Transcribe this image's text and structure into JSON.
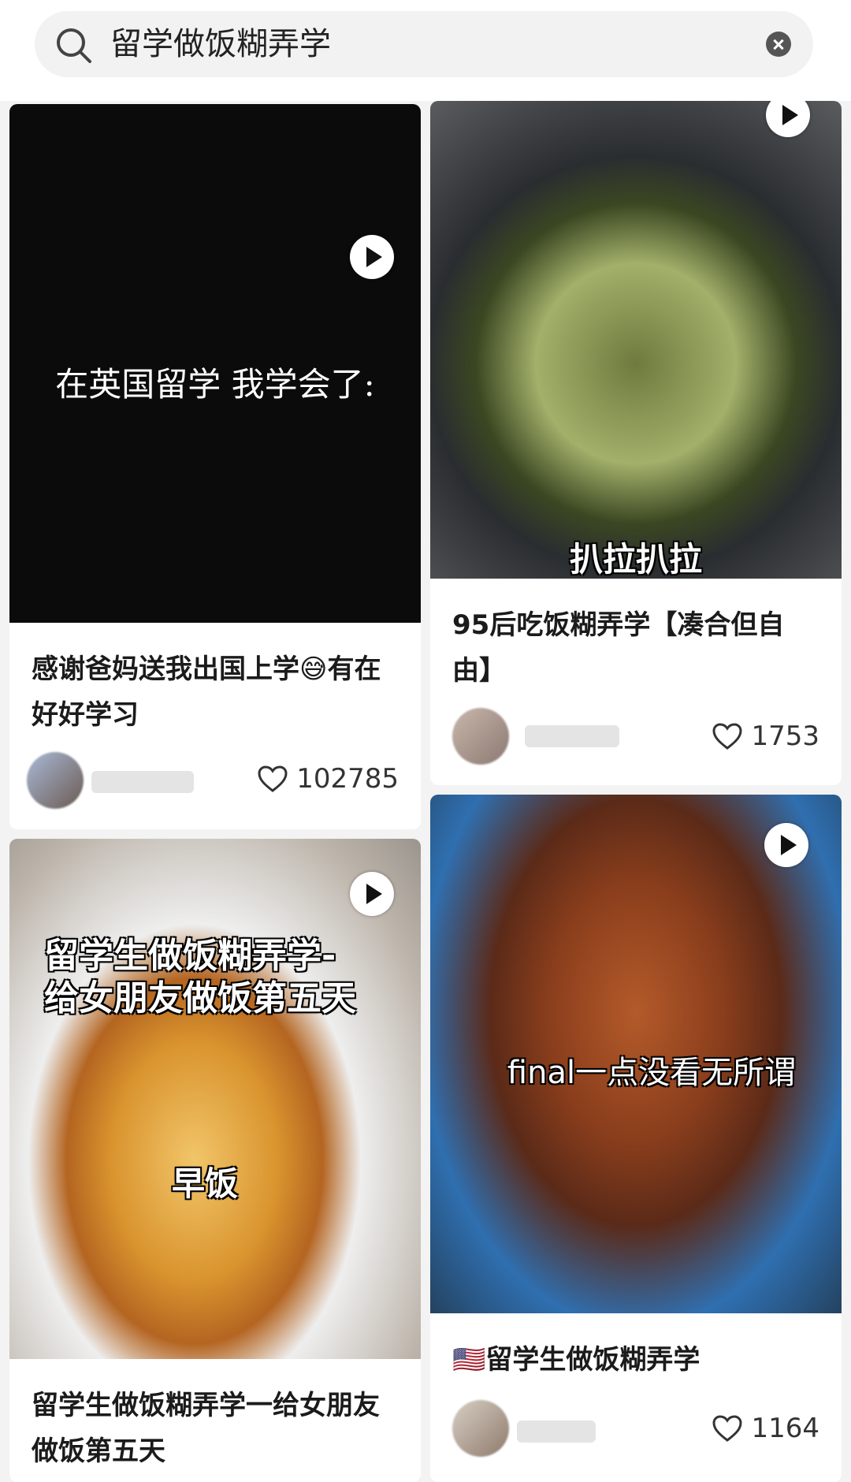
{
  "search": {
    "query": "留学做饭糊弄学"
  },
  "cards": [
    {
      "overlay": "在英国留学 我学会了:",
      "title": "感谢爸妈送我出国上学😅有在好好学习",
      "likes": "102785"
    },
    {
      "overlay": "扒拉扒拉",
      "title": "95后吃饭糊弄学【凑合但自由】",
      "likes": "1753"
    },
    {
      "overlay_line1": "留学生做饭糊弄学-",
      "overlay_line2": "给女朋友做饭第五天",
      "overlay_sub": "早饭",
      "title": "留学生做饭糊弄学一给女朋友做饭第五天"
    },
    {
      "overlay": "final一点没看无所谓",
      "title": "🇺🇸留学生做饭糊弄学",
      "likes": "1164"
    }
  ]
}
